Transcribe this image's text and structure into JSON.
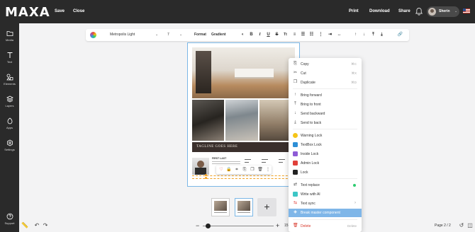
{
  "app": {
    "logo": "MAXA"
  },
  "topbar": {
    "save_label": "Save",
    "close_label": "Close",
    "print_label": "Print",
    "download_label": "Download",
    "share_label": "Share",
    "user_name": "Sherin",
    "user_chevron": "⌄"
  },
  "sidebar": {
    "items": [
      {
        "label": "Media",
        "icon": "folder-icon"
      },
      {
        "label": "Text",
        "icon": "text-icon"
      },
      {
        "label": "Elements",
        "icon": "elements-icon"
      },
      {
        "label": "Layers",
        "icon": "layers-icon"
      },
      {
        "label": "Apps",
        "icon": "apps-icon"
      },
      {
        "label": "Settings",
        "icon": "settings-icon"
      }
    ],
    "support_label": "Support"
  },
  "format_toolbar": {
    "font_family": "Metropolis Light",
    "font_size": "7",
    "format_label": "Format",
    "gradient_label": "Gradient"
  },
  "page_content": {
    "tagline": "TAGLINE GOES HERE",
    "agent_name": "FIRST LAST"
  },
  "context_menu": {
    "items": [
      {
        "label": "Copy",
        "shortcut": "⌘C",
        "icon": "copy-icon"
      },
      {
        "label": "Cut",
        "shortcut": "⌘X",
        "icon": "cut-icon"
      },
      {
        "label": "Duplicate",
        "shortcut": "⌘D",
        "icon": "duplicate-icon"
      },
      {
        "label": "Bring forward",
        "icon": "bring-forward-icon"
      },
      {
        "label": "Bring to front",
        "icon": "bring-to-front-icon"
      },
      {
        "label": "Send backward",
        "icon": "send-backward-icon"
      },
      {
        "label": "Send to back",
        "icon": "send-to-back-icon"
      },
      {
        "label": "Warning Lock",
        "icon": "warning-lock-icon",
        "color": "#f5c518"
      },
      {
        "label": "TextBox Lock",
        "icon": "textbox-lock-icon",
        "color": "#2d8fd6"
      },
      {
        "label": "Inside Lock",
        "icon": "inside-lock-icon",
        "color": "#8e5bd6"
      },
      {
        "label": "Admin Lock",
        "icon": "admin-lock-icon",
        "color": "#e0403a"
      },
      {
        "label": "Lock",
        "icon": "lock-icon",
        "color": "#222222"
      },
      {
        "label": "Text replace",
        "icon": "text-replace-icon"
      },
      {
        "label": "Write with AI",
        "icon": "ai-icon",
        "color": "#3dc6c6"
      },
      {
        "label": "Text sync",
        "icon": "text-sync-icon"
      },
      {
        "label": "Break master component",
        "icon": "break-component-icon"
      },
      {
        "label": "Delete",
        "shortcut": "Delete",
        "icon": "delete-icon"
      }
    ]
  },
  "bottom": {
    "zoom_value": "15",
    "page_counter": "Page 2 / 2",
    "zoom_level_fraction": 0.04
  },
  "colors": {
    "topbar_bg": "#2a2a2a",
    "accent_blue": "#7fb6e8",
    "delete_red": "#d9382c",
    "selection_orange": "#f0a020"
  }
}
